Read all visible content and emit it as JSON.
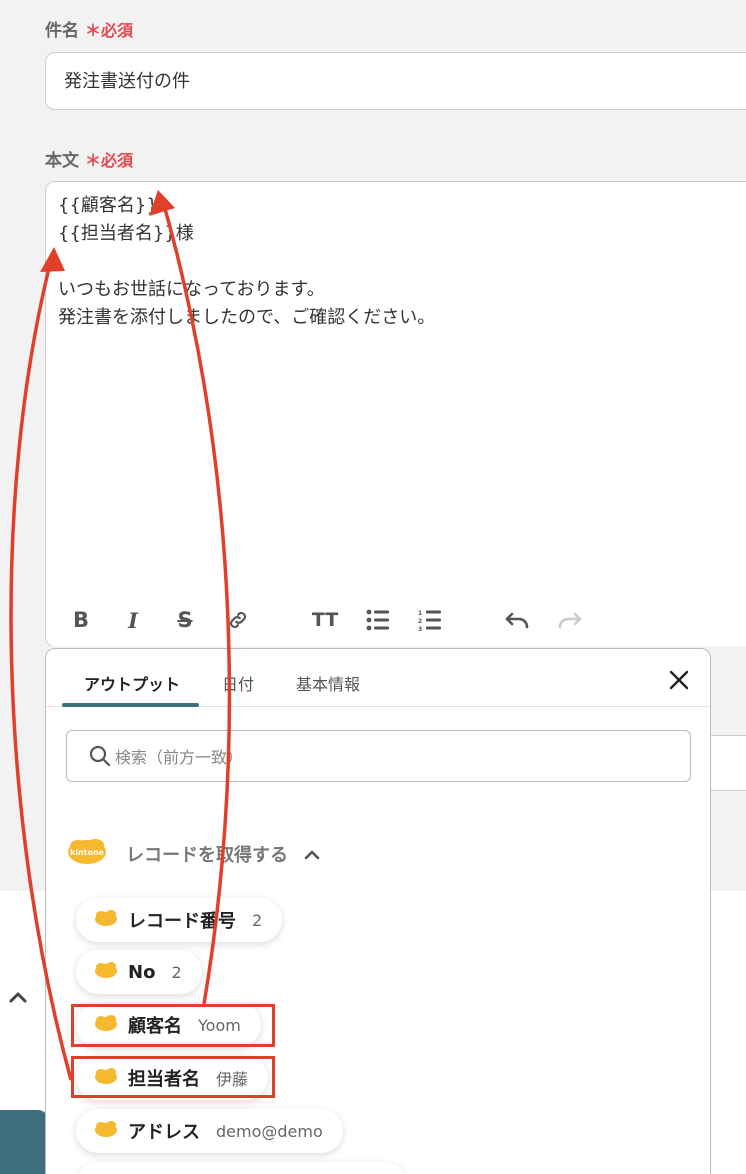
{
  "subject": {
    "label": "件名",
    "required_mark": "＊",
    "required_text": "必須",
    "value": "発注書送付の件"
  },
  "body": {
    "label": "本文",
    "required_mark": "＊",
    "required_text": "必須",
    "lines": [
      "{{顧客名}}",
      "{{担当者名}}様",
      "",
      "いつもお世話になっております。",
      "発注書を添付しましたので、ご確認ください。"
    ]
  },
  "toolbar": {
    "bold": "B",
    "italic": "I",
    "strike": "S",
    "link": "link",
    "font_size": "TT",
    "bullet_list": "list",
    "numbered_list": "numbered-list",
    "undo": "undo",
    "redo": "redo"
  },
  "popup": {
    "tabs": [
      "アウトプット",
      "日付",
      "基本情報"
    ],
    "active_tab": "アウトプット",
    "search_placeholder": "検索（前方一致）",
    "group": {
      "label": "レコードを取得する",
      "icon": "kintone"
    },
    "items": [
      {
        "name": "レコード番号",
        "value": "2"
      },
      {
        "name": "No",
        "value": "2"
      },
      {
        "name": "顧客名",
        "value": "Yoom"
      },
      {
        "name": "担当者名",
        "value": "伊藤"
      },
      {
        "name": "アドレス",
        "value": "demo@demo"
      }
    ]
  },
  "colors": {
    "accent": "#3d6e7e",
    "required": "#e5484d",
    "annotation": "#e0402a",
    "kintone": "#f5b82e"
  }
}
